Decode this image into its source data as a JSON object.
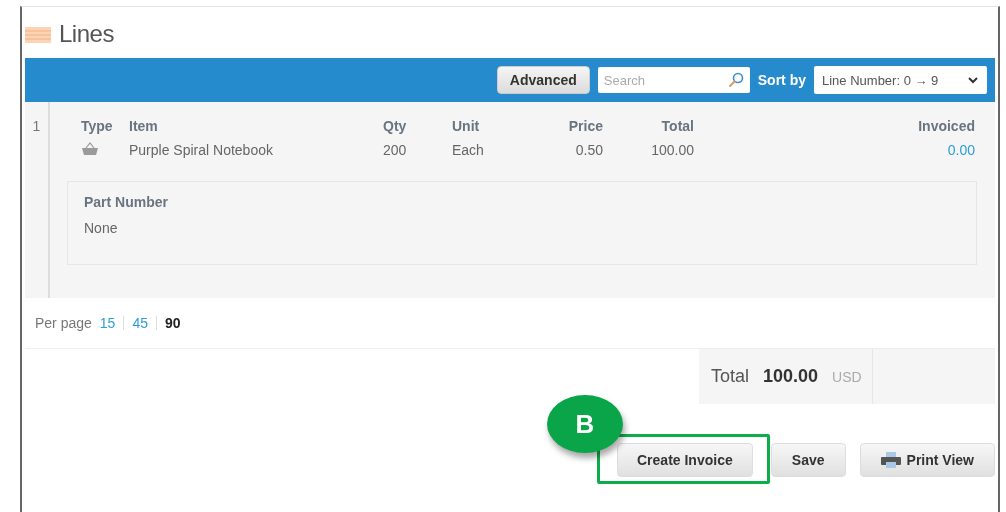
{
  "section": {
    "title": "Lines"
  },
  "toolbar": {
    "advanced_button": "Advanced",
    "search": {
      "placeholder": "Search"
    },
    "sort_label": "Sort by",
    "sort_value": "Line Number: 0 → 9"
  },
  "table": {
    "columns": [
      "Type",
      "Item",
      "Qty",
      "Unit",
      "Price",
      "Total",
      "Invoiced"
    ],
    "rows": [
      {
        "line": "1",
        "item": "Purple Spiral Notebook",
        "qty": "200",
        "unit": "Each",
        "price": "0.50",
        "total": "100.00",
        "invoiced": "0.00",
        "detail_label": "Part Number",
        "detail_value": "None"
      }
    ]
  },
  "pagination": {
    "label": "Per page",
    "options": [
      {
        "label": "15",
        "selected": false
      },
      {
        "label": "45",
        "selected": false
      },
      {
        "label": "90",
        "selected": true
      }
    ]
  },
  "summary": {
    "label": "Total",
    "amount": "100.00",
    "currency": "USD"
  },
  "buttons": [
    {
      "label": "Create Invoice",
      "kind": "plain",
      "highlighted": true
    },
    {
      "label": "Save",
      "kind": "plain",
      "highlighted": false
    },
    {
      "label": "Print View",
      "kind": "print",
      "highlighted": false
    }
  ],
  "annotation": {
    "label": "B"
  }
}
